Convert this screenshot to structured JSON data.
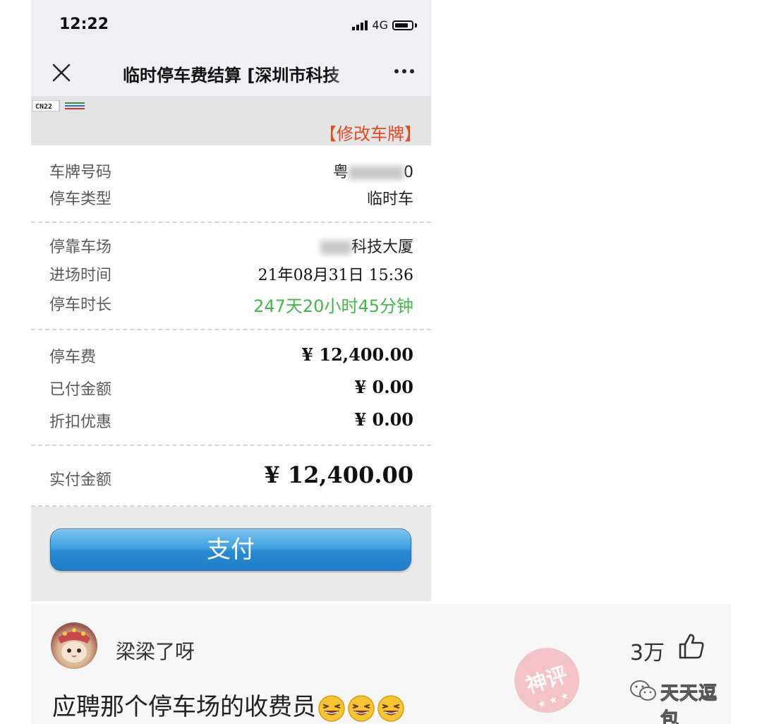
{
  "status_bar": {
    "time": "12:22",
    "network": "4G"
  },
  "nav": {
    "title": "临时停车费结算 [深圳市科技"
  },
  "plate_band": {
    "mini_plate_text": "CN22",
    "modify_plate_label": "【修改车牌】"
  },
  "details": {
    "plate_label": "车牌号码",
    "plate_value_prefix": "粤",
    "plate_value_suffix": "0",
    "type_label": "停车类型",
    "type_value": "临时车",
    "lot_label": "停靠车场",
    "lot_value": "科技大厦",
    "entry_label": "进场时间",
    "entry_value": "21年08月31日 15:36",
    "duration_label": "停车时长",
    "duration_value": "247天20小时45分钟",
    "fee_label": "停车费",
    "fee_value": "¥ 12,400.00",
    "paid_label": "已付金额",
    "paid_value": "¥ 0.00",
    "discount_label": "折扣优惠",
    "discount_value": "¥ 0.00",
    "actual_label": "实付金额",
    "actual_value": "¥ 12,400.00"
  },
  "pay_button": {
    "label": "支付"
  },
  "comment": {
    "username": "梁梁了呀",
    "like_count": "3万",
    "text": "应聘那个停车场的收费员",
    "emoji_count": 3,
    "stamp_text": "神评",
    "watermark": "天天逗包"
  },
  "colors": {
    "modify_plate": "#e24a21",
    "duration_green": "#45b649",
    "pay_button_blue": "#2f93d8"
  }
}
